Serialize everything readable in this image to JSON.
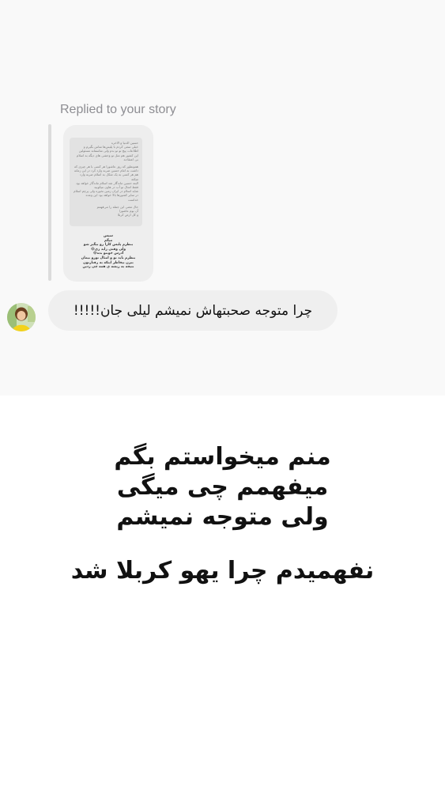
{
  "story_reply": {
    "label": "Replied to your story",
    "thumbnail": {
      "card_lines": [
        "حسین الدنیا و الاخره",
        "خیلی سعی کردم با پلیس‌ها تماس بگیرم و",
        "اطلاعات پیچ تو تو بدم ولی متاسفانه مسئولین",
        "این کشور هم مثل تو وحشی های دیگه به اسلام",
        "بی اعتقادند",
        "",
        "همونطور که روز عاشورا هر کسی با هر چیزی که",
        "داشت به امام حسین ضربه وارد کرد در این زمانه",
        "هم هر کسی به یک شکل به اسلام ضربه وارد",
        "میکنه",
        "البته حسین ماندگار شد اسلام ماندگار خواهد بود",
        "فقط امثال تو آب در هاون میکوبید",
        "شاید اسلام در ایران زمین نخوره ولی پرچم اسلام",
        "در سایر کشورها بالا خواهد بود این وعده",
        "خداست",
        "",
        "حال معنی این جمله را می‌فهمم",
        "آن یوم عاشورا",
        "و کل ارض کربلا"
      ],
      "caption_lines": [
        "سپس",
        "میگم",
        "بنظرم پلیس کارا رو بیگیر شو",
        "ولی وقتی زاید زی😂",
        "آدرس خونتو بده😂",
        "بنظرم باید تو و امثال توزو بیمان",
        "ببرن بیخاطر اینکه به رفتارتون",
        "نتیجه به ریشه ی همه چی زدین"
      ]
    },
    "message": "چرا متوجه صحبتهاش نمیشم لیلی جان!!!!!"
  },
  "overlay": {
    "line1": "منم میخواستم بگم",
    "line2": "میفهمم چی میگی",
    "line3": "ولی متوجه نمیشم",
    "line4": "نفهمیدم چرا یهو کربلا شد"
  },
  "colors": {
    "label_gray": "#8e8e93",
    "bubble_bg": "#efefef",
    "panel_bg": "#f9f9f9"
  }
}
